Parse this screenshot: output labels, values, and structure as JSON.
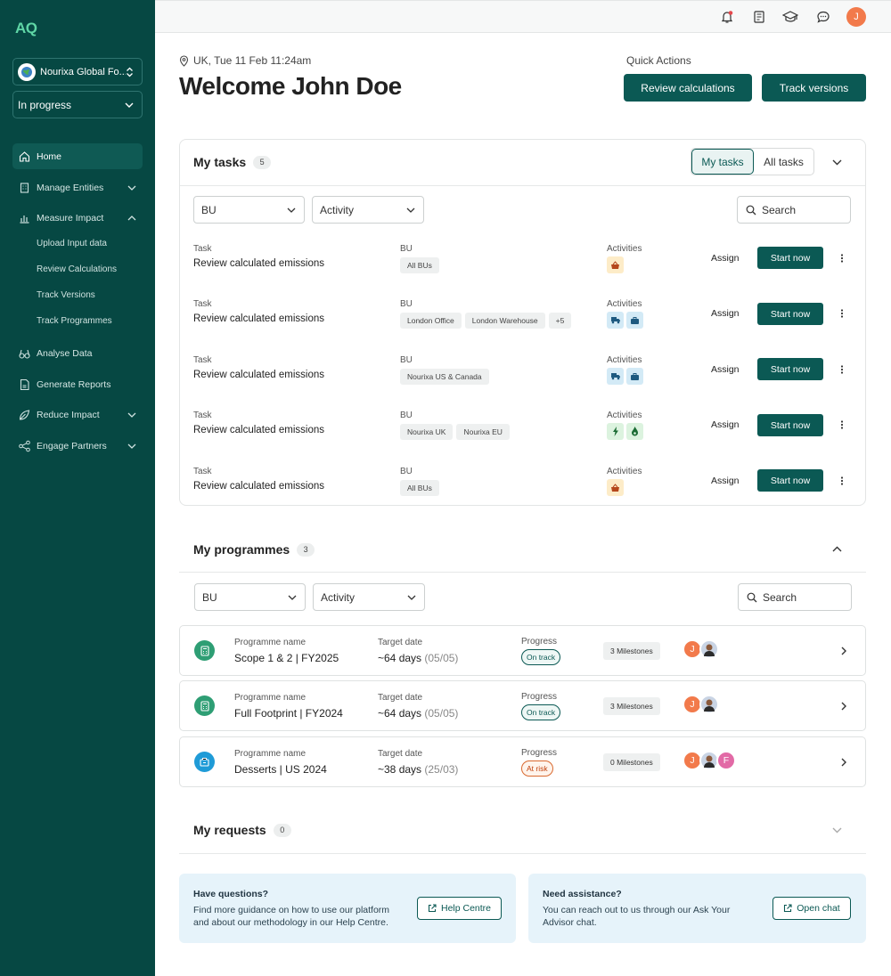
{
  "sidebar": {
    "logo": "AQ",
    "org_selector": "Nourixa Global Fo...",
    "status_selector": "In progress",
    "nav": [
      {
        "label": "Home",
        "icon": "home-icon"
      },
      {
        "label": "Manage Entities",
        "icon": "building-icon"
      },
      {
        "label": "Measure Impact",
        "icon": "bar-chart-icon"
      },
      {
        "label": "Analyse Data",
        "icon": "binoculars-icon"
      },
      {
        "label": "Generate Reports",
        "icon": "report-icon"
      },
      {
        "label": "Reduce Impact",
        "icon": "leaf-icon"
      },
      {
        "label": "Engage Partners",
        "icon": "share-icon"
      }
    ],
    "sub_items": [
      "Upload Input data",
      "Review Calculations",
      "Track Versions",
      "Track Programmes"
    ]
  },
  "topbar": {
    "user_initial": "J"
  },
  "header": {
    "location": "UK, Tue 11 Feb 11:24am",
    "welcome": "Welcome John Doe",
    "quick_actions_label": "Quick Actions",
    "review_btn": "Review calculations",
    "track_btn": "Track versions"
  },
  "tasks": {
    "title": "My tasks",
    "count": "5",
    "tab_mine": "My tasks",
    "tab_all": "All tasks",
    "filter_bu": "BU",
    "filter_activity": "Activity",
    "search": "Search",
    "col_task": "Task",
    "col_bu": "BU",
    "col_activities": "Activities",
    "assign": "Assign",
    "start": "Start now",
    "rows": [
      {
        "name": "Review calculated emissions",
        "bus": [
          "All BUs"
        ]
      },
      {
        "name": "Review  calculated emissions",
        "bus": [
          "London Office",
          "London Warehouse",
          "+5"
        ]
      },
      {
        "name": "Review calculated emissions",
        "bus": [
          "Nourixa US & Canada"
        ]
      },
      {
        "name": "Review calculated emissions",
        "bus": [
          "Nourixa UK",
          "Nourixa EU"
        ]
      },
      {
        "name": "Review calculated emissions",
        "bus": [
          "All BUs"
        ]
      }
    ]
  },
  "programmes": {
    "title": "My programmes",
    "count": "3",
    "filter_bu": "BU",
    "filter_activity": "Activity",
    "search": "Search",
    "lbl_name": "Programme name",
    "lbl_target": "Target date",
    "lbl_progress": "Progress",
    "rows": [
      {
        "name": "Scope 1 & 2 | FY2025",
        "days": "~64 days",
        "date": "(05/05)",
        "status": "On track",
        "milestones": "3 Milestones",
        "avatars": [
          "J",
          "",
          ""
        ]
      },
      {
        "name": "Full Footprint | FY2024",
        "days": "~64 days",
        "date": "(05/05)",
        "status": "On track",
        "milestones": "3 Milestones",
        "avatars": [
          "J",
          ""
        ]
      },
      {
        "name": "Desserts | US 2024",
        "days": "~38 days",
        "date": "(25/03)",
        "status": "At risk",
        "milestones": "0 Milestones",
        "avatars": [
          "J",
          "",
          "F"
        ]
      }
    ]
  },
  "requests": {
    "title": "My requests",
    "count": "0"
  },
  "help": {
    "q_title": "Have questions?",
    "q_text_1": "Find more guidance on how to use our platform",
    "q_text_2": "and about our methodology in our Help Centre.",
    "q_btn": "Help Centre",
    "a_title": "Need assistance?",
    "a_text_1": "You can reach out to us through our Ask Your",
    "a_text_2": "Advisor chat.",
    "a_btn": "Open chat"
  },
  "colors": {
    "brand": "#064843",
    "primary_button": "#0b5954",
    "on_track": "#0b5954",
    "at_risk": "#c2410c"
  }
}
